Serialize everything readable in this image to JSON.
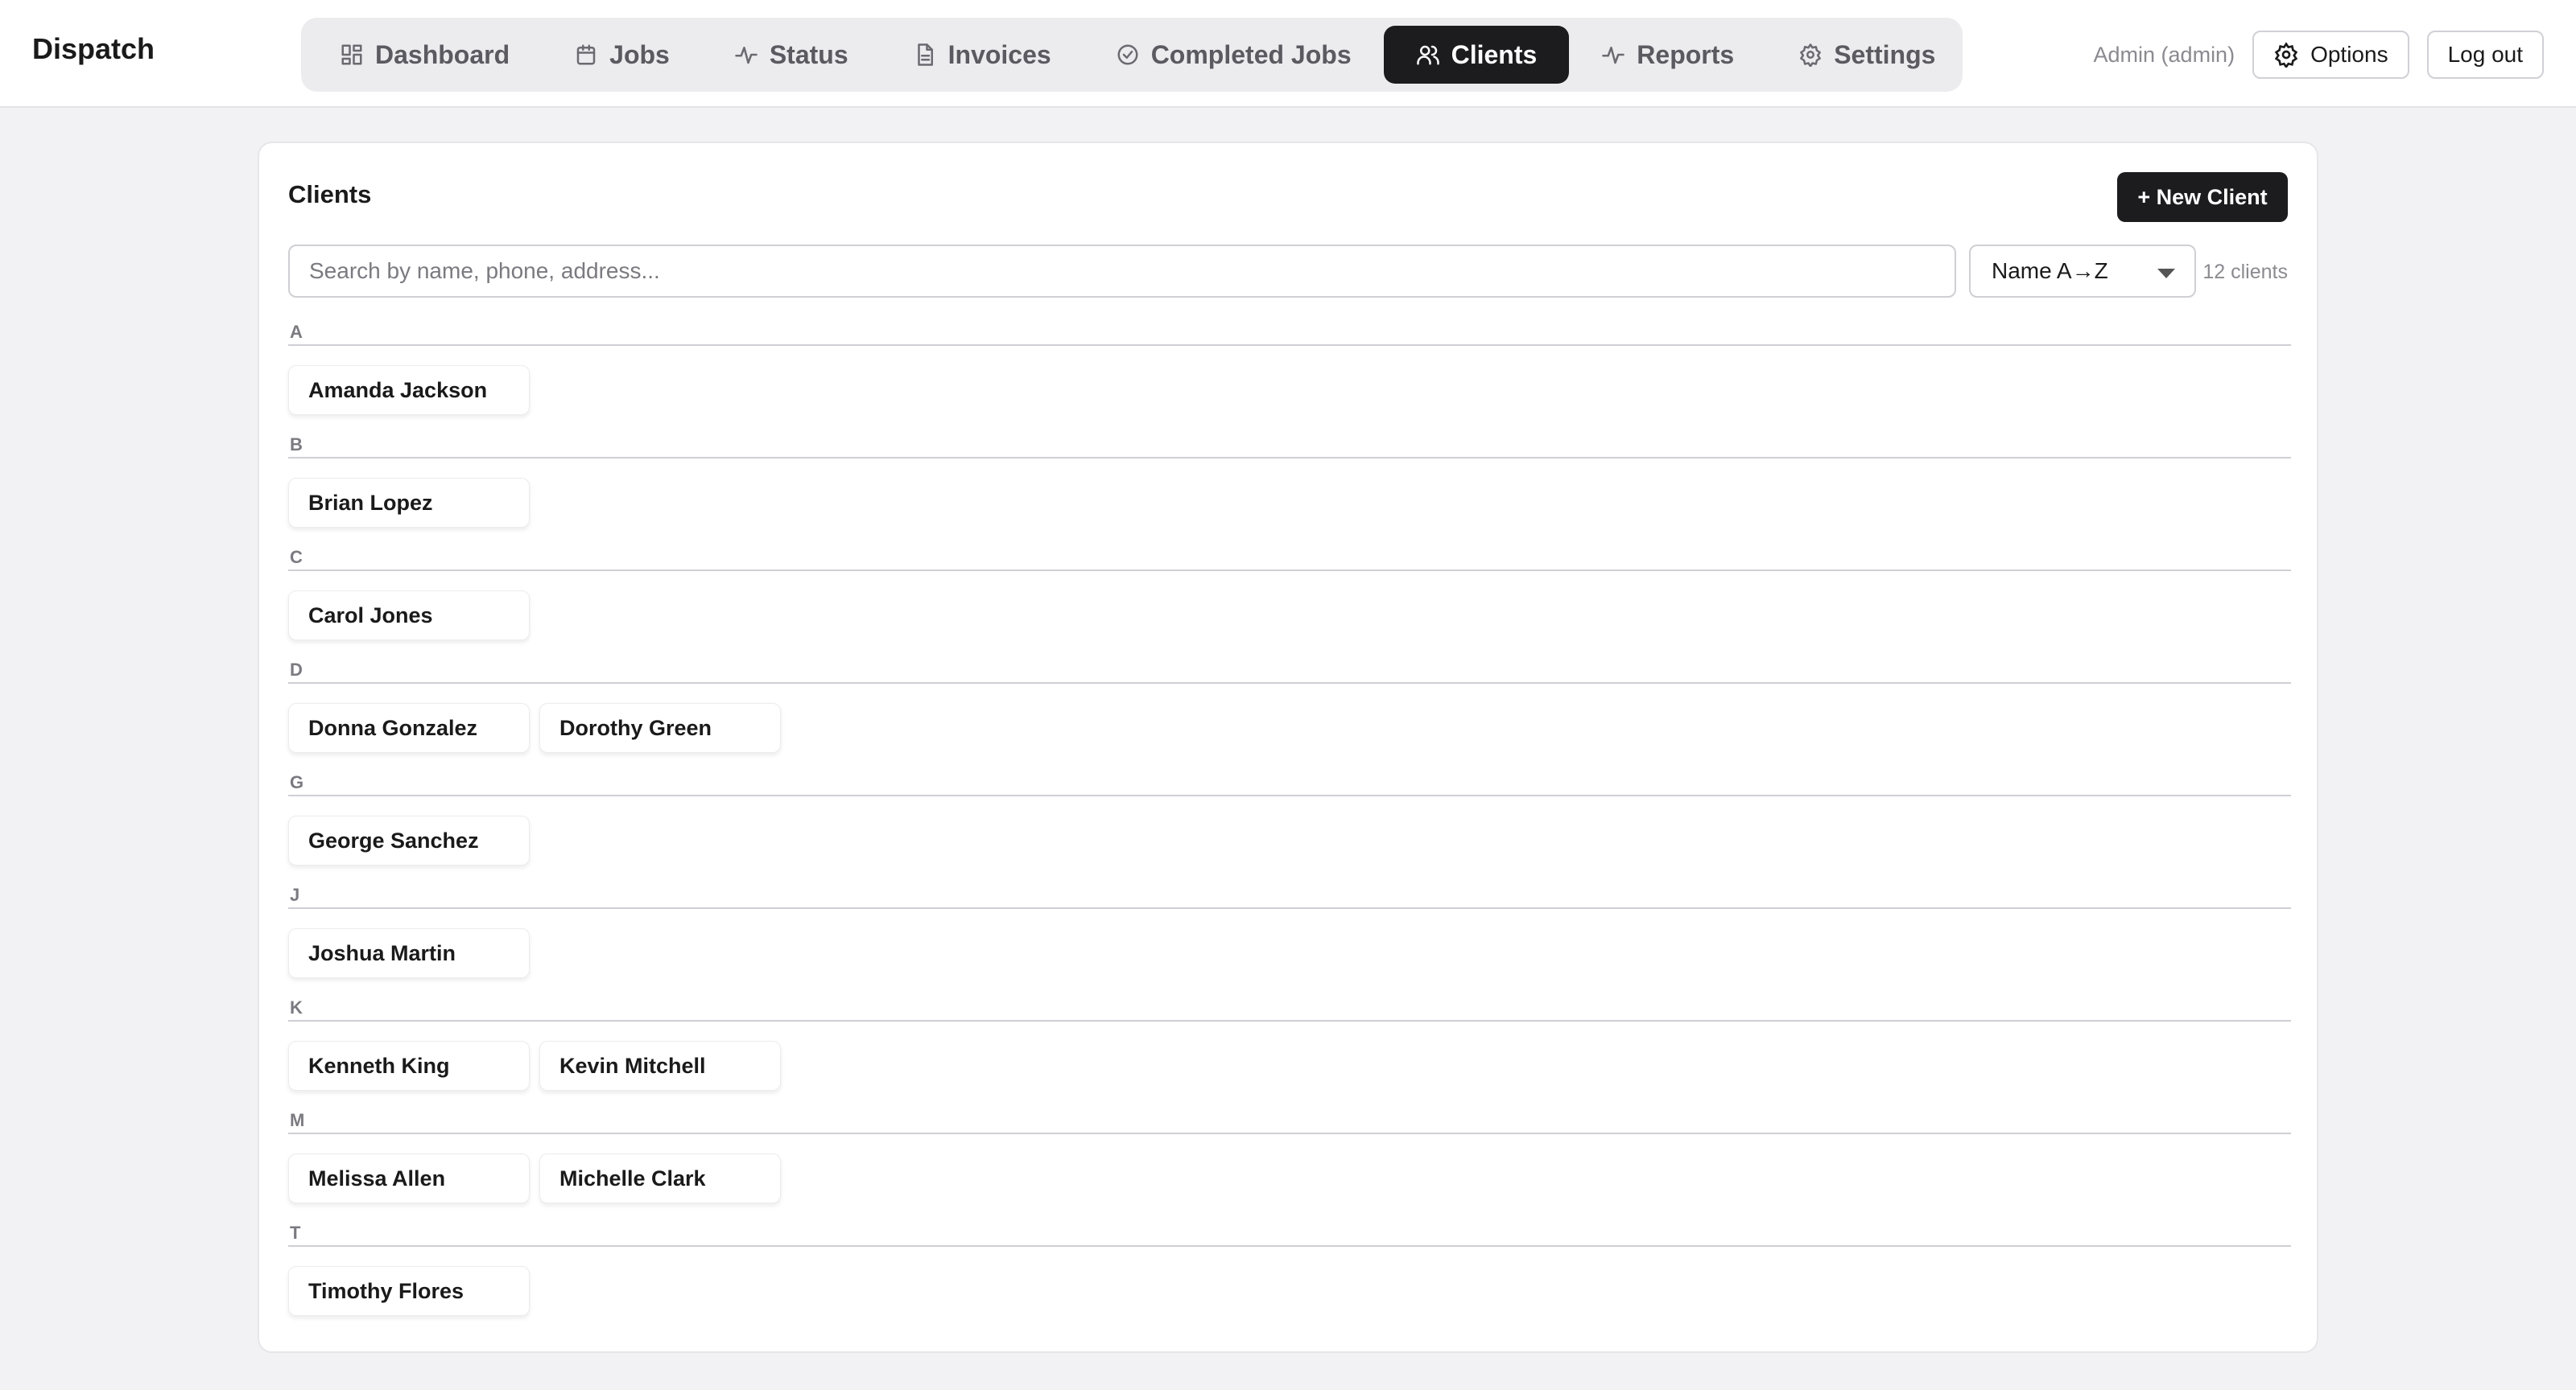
{
  "app": {
    "brand": "Dispatch"
  },
  "nav": [
    {
      "label": "Dashboard",
      "icon": "dashboard-icon",
      "active": false
    },
    {
      "label": "Jobs",
      "icon": "calendar-icon",
      "active": false
    },
    {
      "label": "Status",
      "icon": "activity-icon",
      "active": false
    },
    {
      "label": "Invoices",
      "icon": "document-icon",
      "active": false
    },
    {
      "label": "Completed Jobs",
      "icon": "check-circle-icon",
      "active": false
    },
    {
      "label": "Clients",
      "icon": "users-icon",
      "active": true
    },
    {
      "label": "Reports",
      "icon": "activity-icon",
      "active": false
    },
    {
      "label": "Settings",
      "icon": "gear-icon",
      "active": false
    }
  ],
  "header": {
    "user": "Admin (admin)",
    "options_label": "Options",
    "logout_label": "Log out"
  },
  "clients_panel": {
    "title": "Clients",
    "new_button": "+ New Client",
    "search_placeholder": "Search by name, phone, address...",
    "search_value": "",
    "sort_selected": "Name A→Z",
    "count_label": "12 clients",
    "groups": [
      {
        "letter": "A",
        "clients": [
          "Amanda Jackson"
        ]
      },
      {
        "letter": "B",
        "clients": [
          "Brian Lopez"
        ]
      },
      {
        "letter": "C",
        "clients": [
          "Carol Jones"
        ]
      },
      {
        "letter": "D",
        "clients": [
          "Donna Gonzalez",
          "Dorothy Green"
        ]
      },
      {
        "letter": "G",
        "clients": [
          "George Sanchez"
        ]
      },
      {
        "letter": "J",
        "clients": [
          "Joshua Martin"
        ]
      },
      {
        "letter": "K",
        "clients": [
          "Kenneth King",
          "Kevin Mitchell"
        ]
      },
      {
        "letter": "M",
        "clients": [
          "Melissa Allen",
          "Michelle Clark"
        ]
      },
      {
        "letter": "T",
        "clients": [
          "Timothy Flores"
        ]
      }
    ]
  },
  "colors": {
    "accent": "#1c1c1e",
    "background": "#f2f2f5",
    "muted_text": "#8a8a90"
  }
}
